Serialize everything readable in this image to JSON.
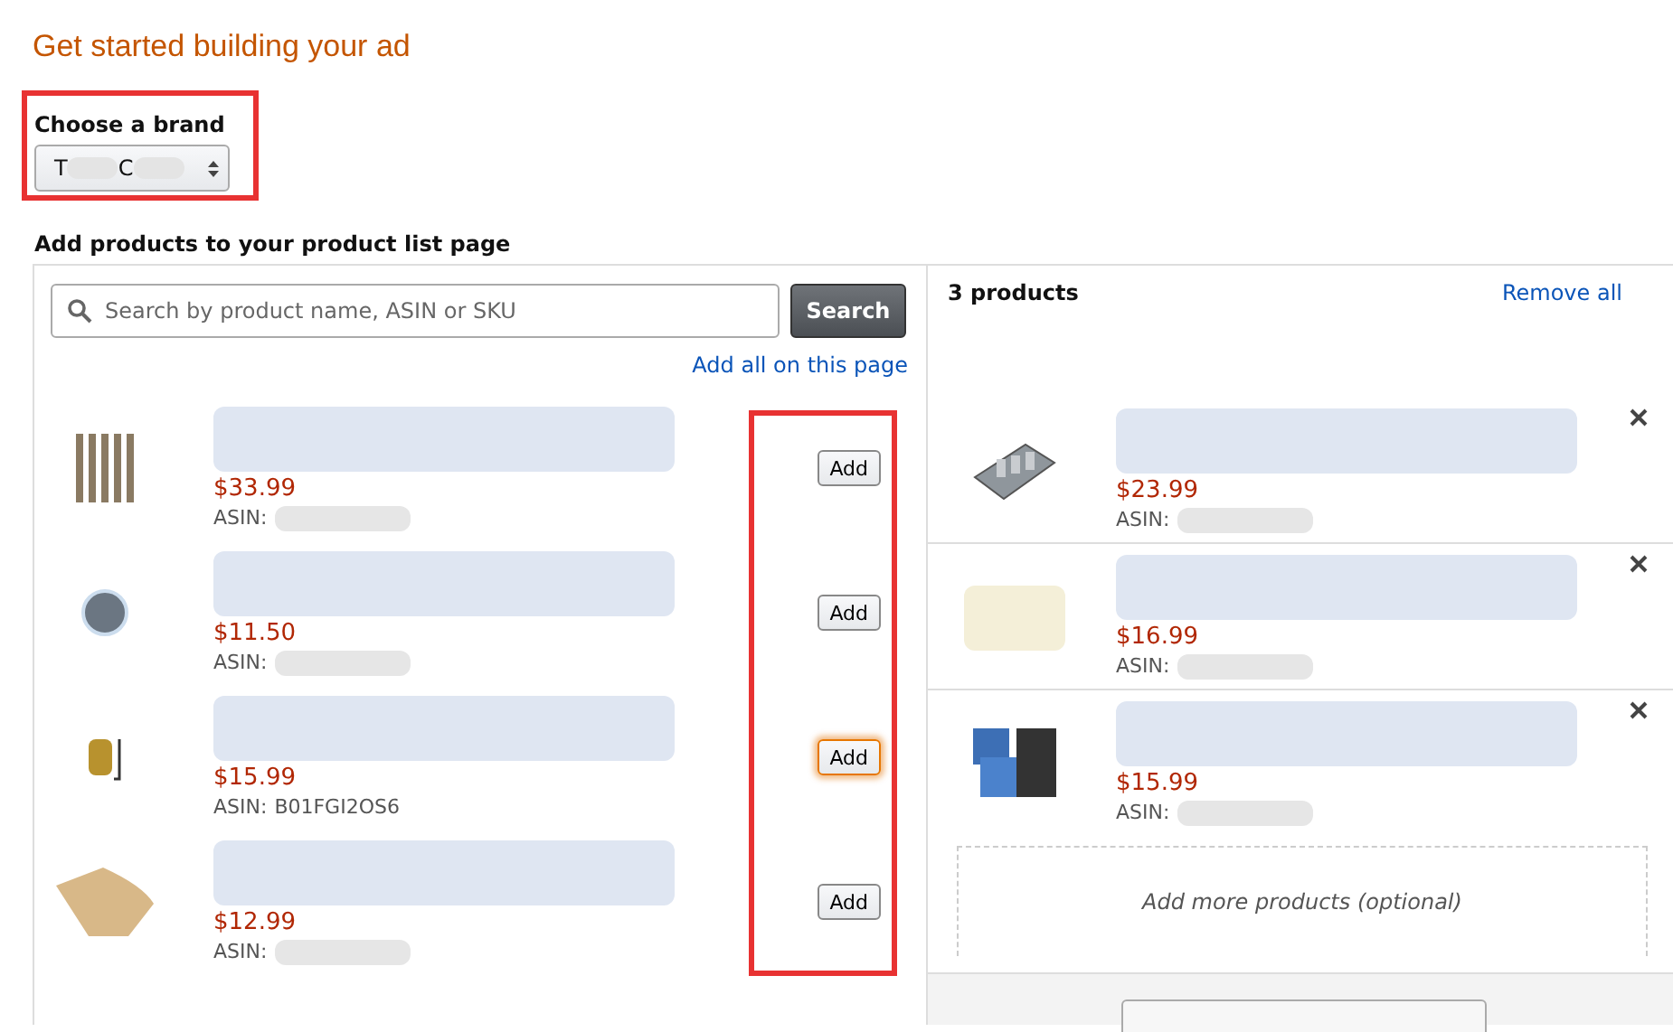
{
  "heading": "Get started building your ad",
  "brand": {
    "label": "Choose a brand",
    "letters": [
      "T",
      "C"
    ]
  },
  "products_label": "Add products to your product list page",
  "search": {
    "placeholder": "Search by product name, ASIN or SKU",
    "button": "Search",
    "add_all": "Add all on this page"
  },
  "results": [
    {
      "kind": "rods",
      "price": "$33.99",
      "asin_label": "ASIN:",
      "button": "Add",
      "focused": false
    },
    {
      "kind": "disc",
      "price": "$11.50",
      "asin_label": "ASIN:",
      "button": "Add",
      "focused": false
    },
    {
      "kind": "fitting",
      "price": "$15.99",
      "asin_label": "ASIN:",
      "asin": "B01FGI2OS6",
      "button": "Add",
      "focused": true
    },
    {
      "kind": "filter-cone",
      "price": "$12.99",
      "asin_label": "ASIN:",
      "button": "Add",
      "focused": false
    }
  ],
  "list": {
    "count": "3 products",
    "remove_all": "Remove all",
    "placeholder": "Add more products (optional)",
    "items": [
      {
        "kind": "heater",
        "price": "$23.99",
        "asin_label": "ASIN:"
      },
      {
        "kind": "sponge",
        "price": "$16.99",
        "asin_label": "ASIN:"
      },
      {
        "kind": "pads",
        "price": "$15.99",
        "asin_label": "ASIN:"
      }
    ]
  }
}
